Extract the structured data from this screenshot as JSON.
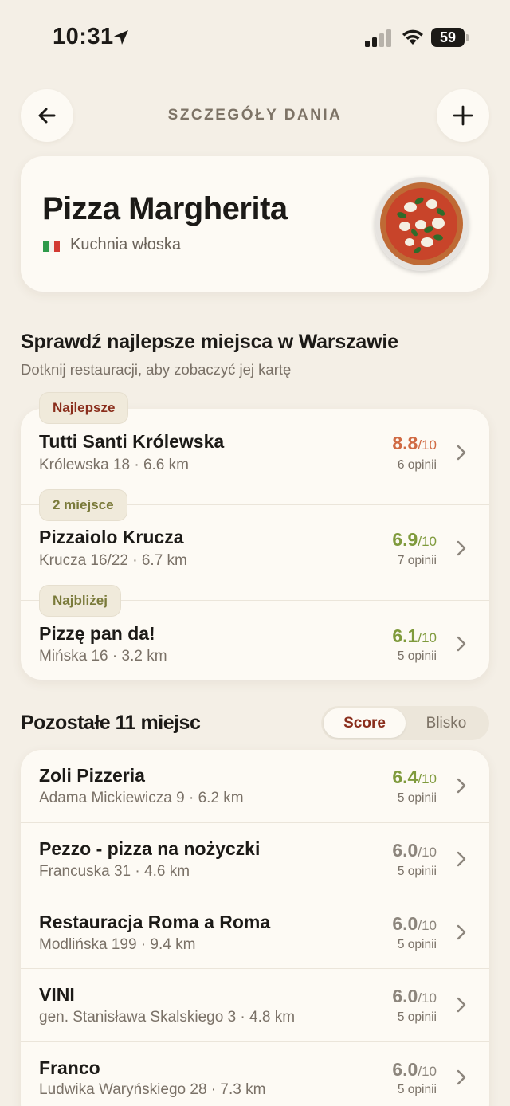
{
  "status_bar": {
    "time": "10:31",
    "battery": "59"
  },
  "header": {
    "title": "SZCZEGÓŁY DANIA"
  },
  "dish": {
    "name": "Pizza Margherita",
    "cuisine": "Kuchnia włoska"
  },
  "section": {
    "title": "Sprawdź najlepsze miejsca w Warszawie",
    "subtitle": "Dotknij restauracji, aby zobaczyć jej kartę"
  },
  "top_places": [
    {
      "badge": "Najlepsze",
      "name": "Tutti Santi Królewska",
      "address": "Królewska 18",
      "distance": "6.6 km",
      "score": "8.8",
      "scale": "/10",
      "reviews": "6 opinii"
    },
    {
      "badge": "2 miejsce",
      "name": "Pizzaiolo Krucza",
      "address": "Krucza 16/22",
      "distance": "6.7 km",
      "score": "6.9",
      "scale": "/10",
      "reviews": "7 opinii"
    },
    {
      "badge": "Najbliżej",
      "name": "Pizzę pan da!",
      "address": "Mińska 16",
      "distance": "3.2 km",
      "score": "6.1",
      "scale": "/10",
      "reviews": "5 opinii"
    }
  ],
  "others": {
    "title": "Pozostałe 11 miejsc",
    "sort_options": [
      "Score",
      "Blisko"
    ],
    "selected_sort": "Score",
    "items": [
      {
        "name": "Zoli Pizzeria",
        "address": "Adama Mickiewicza 9",
        "distance": "6.2 km",
        "score": "6.4",
        "scale": "/10",
        "reviews": "5 opinii"
      },
      {
        "name": "Pezzo - pizza na nożyczki",
        "address": "Francuska 31",
        "distance": "4.6 km",
        "score": "6.0",
        "scale": "/10",
        "reviews": "5 opinii"
      },
      {
        "name": "Restauracja Roma a Roma",
        "address": "Modlińska 199",
        "distance": "9.4 km",
        "score": "6.0",
        "scale": "/10",
        "reviews": "5 opinii"
      },
      {
        "name": "VINI",
        "address": "gen. Stanisława Skalskiego 3",
        "distance": "4.8 km",
        "score": "6.0",
        "scale": "/10",
        "reviews": "5 opinii"
      },
      {
        "name": "Franco",
        "address": "Ludwika Waryńskiego 28",
        "distance": "7.3 km",
        "score": "6.0",
        "scale": "/10",
        "reviews": "5 opinii"
      }
    ]
  },
  "colors": {
    "background": "#f4efe6",
    "card": "#fdfaf4",
    "score_best": "#d06a43",
    "score_good": "#7f9a3c",
    "score_neutral": "#8c857c",
    "badge_best_text": "#8a2e1c",
    "badge_other_text": "#7a7a3a",
    "accent_sort": "#8a2e1c"
  },
  "icons": {
    "back": "arrow-left-icon",
    "add": "plus-icon",
    "chevron": "chevron-right-icon",
    "flag": "italy-flag-icon",
    "location": "location-arrow-icon",
    "signal": "cellular-signal-icon",
    "wifi": "wifi-icon",
    "battery": "battery-icon"
  }
}
